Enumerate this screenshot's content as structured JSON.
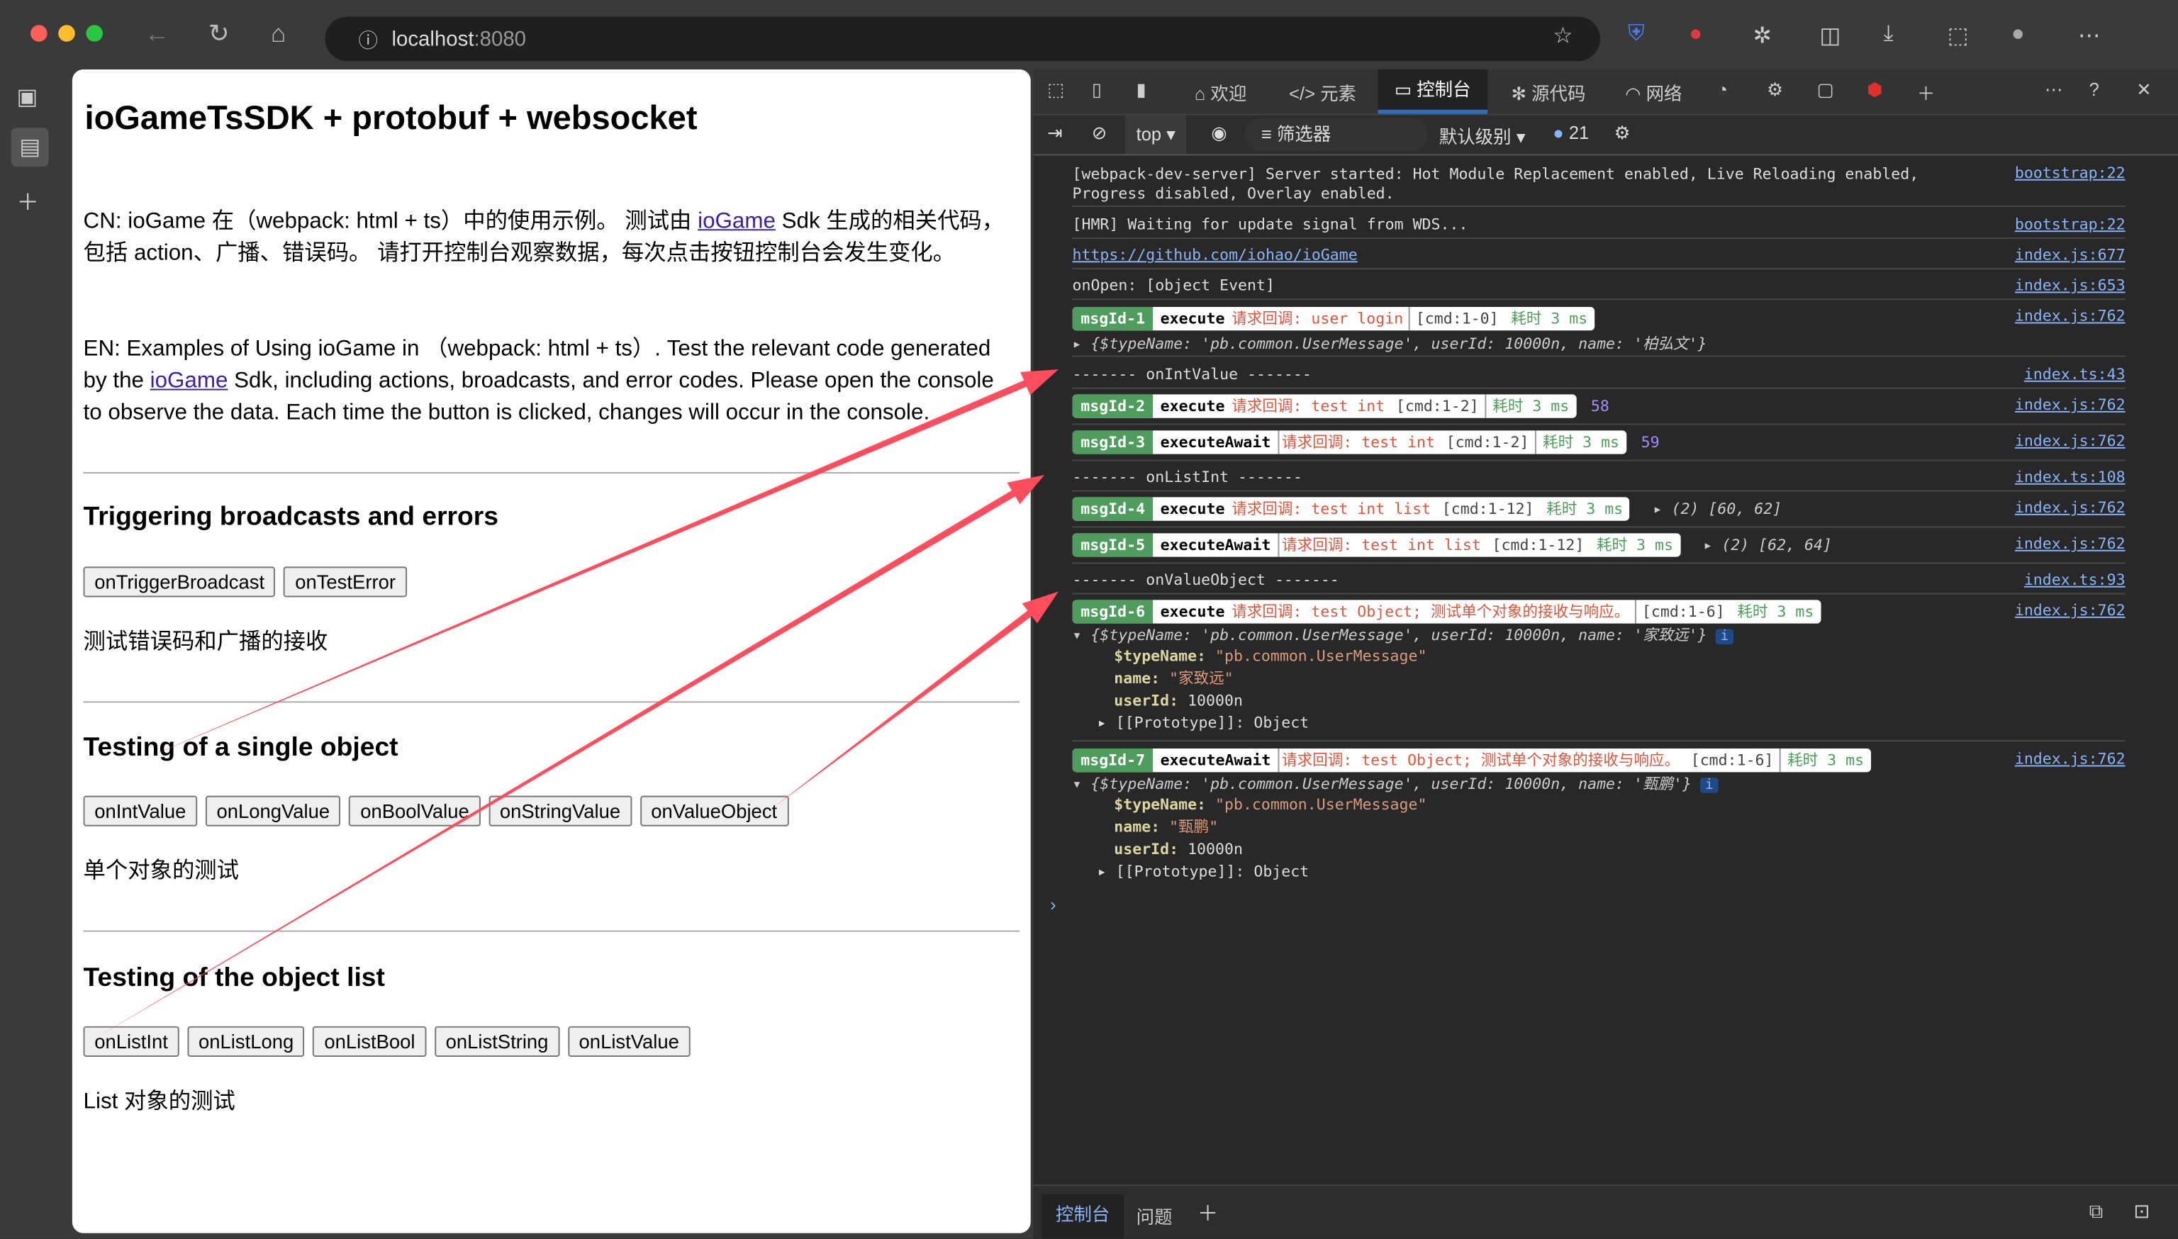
{
  "browser": {
    "url": "localhost:8080",
    "url_port": ":8080",
    "url_host": "localhost"
  },
  "page": {
    "title": "ioGameTsSDK + protobuf + websocket",
    "cn_pre": "CN: ioGame 在（webpack: html + ts）中的使用示例。 测试由 ",
    "cn_link": "ioGame",
    "cn_post": " Sdk 生成的相关代码，包括 action、广播、错误码。 请打开控制台观察数据，每次点击按钮控制台会发生变化。",
    "en_pre": "EN: Examples of Using ioGame in （webpack: html + ts）. Test the relevant code generated by the ",
    "en_link": "ioGame",
    "en_post": " Sdk, including actions, broadcasts, and error codes. Please open the console to observe the data. Each time the button is clicked, changes will occur in the console.",
    "sections": [
      {
        "heading": "Triggering broadcasts and errors",
        "buttons": [
          "onTriggerBroadcast",
          "onTestError"
        ],
        "note": "测试错误码和广播的接收"
      },
      {
        "heading": "Testing of a single object",
        "buttons": [
          "onIntValue",
          "onLongValue",
          "onBoolValue",
          "onStringValue",
          "onValueObject"
        ],
        "note": "单个对象的测试"
      },
      {
        "heading": "Testing of the object list",
        "buttons": [
          "onListInt",
          "onListLong",
          "onListBool",
          "onListString",
          "onListValue"
        ],
        "note": "List 对象的测试"
      }
    ]
  },
  "devtools": {
    "tabs": [
      "欢迎",
      "元素",
      "控制台",
      "源代码",
      "网络"
    ],
    "context": "top",
    "filter_placeholder": "筛选器",
    "level": "默认级别",
    "message_count": "21",
    "bottom_tabs": [
      "控制台",
      "问题"
    ],
    "logs": {
      "l1": {
        "text": "[webpack-dev-server] Server started: Hot Module Replacement enabled, Live Reloading enabled, Progress disabled, Overlay enabled.",
        "src": "bootstrap:22"
      },
      "l2": {
        "text": "[HMR] Waiting for update signal from WDS...",
        "src": "bootstrap:22"
      },
      "l3": {
        "text": "https://github.com/iohao/ioGame",
        "src": "index.js:677"
      },
      "l4": {
        "text": "onOpen: [object Event]",
        "src": "index.js:653"
      },
      "m1": {
        "id": "msgId-1",
        "method": "execute",
        "title": "请求回调: user login",
        "cmd": "[cmd:1-0]",
        "ms": "耗时 3 ms",
        "src": "index.js:762",
        "obj": "{$typeName: 'pb.common.UserMessage', userId: 10000n, name: '柏弘文'}"
      },
      "s1": {
        "text": "------- onIntValue -------",
        "src": "index.ts:43"
      },
      "m2": {
        "id": "msgId-2",
        "method": "execute",
        "title": "请求回调: test int",
        "cmd": "[cmd:1-2]",
        "ms": "耗时 3 ms",
        "value": "58",
        "src": "index.js:762"
      },
      "m3": {
        "id": "msgId-3",
        "method": "executeAwait",
        "title": "请求回调: test int",
        "cmd": "[cmd:1-2]",
        "ms": "耗时 3 ms",
        "value": "59",
        "src": "index.js:762"
      },
      "s2": {
        "text": "------- onListInt -------",
        "src": "index.ts:108"
      },
      "m4": {
        "id": "msgId-4",
        "method": "execute",
        "title": "请求回调: test int list",
        "cmd": "[cmd:1-12]",
        "ms": "耗时 3 ms",
        "value": "(2) [60, 62]",
        "src": "index.js:762"
      },
      "m5": {
        "id": "msgId-5",
        "method": "executeAwait",
        "title": "请求回调: test int list",
        "cmd": "[cmd:1-12]",
        "ms": "耗时 3 ms",
        "value": "(2) [62, 64]",
        "src": "index.js:762"
      },
      "s3": {
        "text": "------- onValueObject -------",
        "src": "index.ts:93"
      },
      "m6": {
        "id": "msgId-6",
        "method": "execute",
        "title": "请求回调: test Object; 测试单个对象的接收与响应。",
        "cmd": "[cmd:1-6]",
        "ms": "耗时 3 ms",
        "src": "index.js:762",
        "obj": "{$typeName: 'pb.common.UserMessage', userId: 10000n, name: '家致远'}",
        "typeName": "\"pb.common.UserMessage\"",
        "name": "\"家致远\"",
        "userId": "10000n",
        "proto": "[[Prototype]]: Object"
      },
      "m7": {
        "id": "msgId-7",
        "method": "executeAwait",
        "title": "请求回调: test Object; 测试单个对象的接收与响应。",
        "cmd": "[cmd:1-6]",
        "ms": "耗时 3 ms",
        "src": "index.js:762",
        "obj": "{$typeName: 'pb.common.UserMessage', userId: 10000n, name: '甄鹏'}",
        "typeName": "\"pb.common.UserMessage\"",
        "name": "\"甄鹏\"",
        "userId": "10000n",
        "proto": "[[Prototype]]: Object"
      }
    },
    "keys": {
      "typeName": "$typeName:",
      "name": "name:",
      "userId": "userId:"
    }
  },
  "colors": {
    "annotation_arrow": "#ff4d5e",
    "badge_green": "#4f9d5d",
    "active_tab": "#2f6fc2"
  }
}
